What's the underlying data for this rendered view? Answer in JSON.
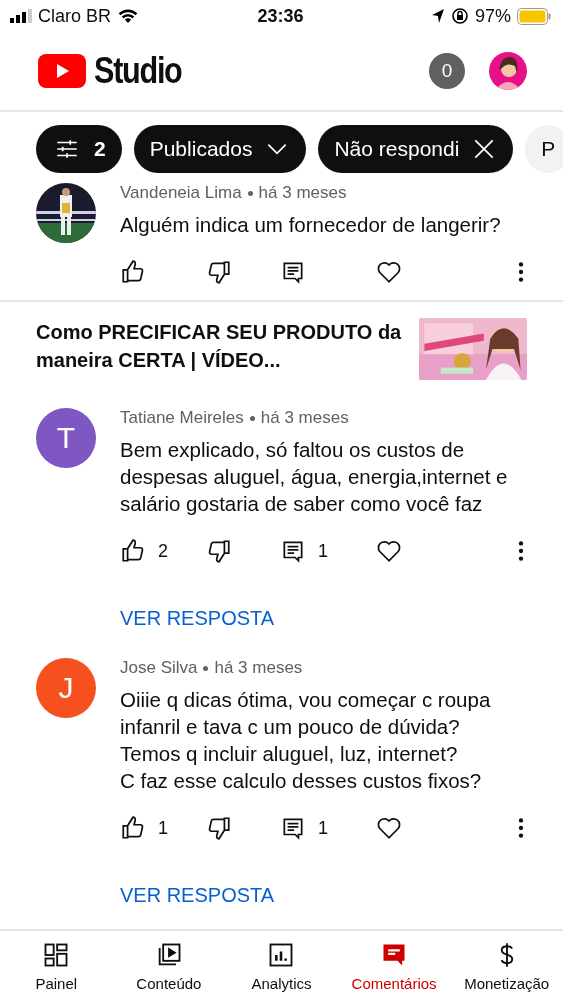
{
  "status_bar": {
    "carrier": "Claro BR",
    "time": "23:36",
    "battery": "97%"
  },
  "header": {
    "logo_text": "Studio",
    "notification_count": "0"
  },
  "filters": [
    {
      "kind": "settings",
      "label": "2"
    },
    {
      "kind": "dropdown",
      "label": "Publicados"
    },
    {
      "kind": "removable",
      "label": "Não respondi"
    },
    {
      "kind": "plain",
      "label": "P"
    }
  ],
  "items": [
    {
      "kind": "comment",
      "author": "Vandeneia Lima",
      "time": "há 3 meses",
      "text": "Alguém indica um fornecedor de langerir?"
    },
    {
      "kind": "video",
      "title": "Como PRECIFICAR SEU PRODUTO da maneira CERTA | VÍDEO..."
    },
    {
      "kind": "comment",
      "author": "Tatiane Meireles",
      "time": "há 3 meses",
      "text": "Bem explicado, só faltou os custos de despesas aluguel, água, energia,internet e salário gostaria de saber como você faz",
      "avatar": {
        "kind": "letter",
        "letter": "T",
        "color": "#7e57c2"
      },
      "likes": "2",
      "replies": "1",
      "reply_link": "VER RESPOSTA"
    },
    {
      "kind": "comment",
      "author": "Jose Silva",
      "time": "há 3 meses",
      "text": "Oiiie q dicas ótima, vou começar c roupa infanril e tava c um pouco de dúvida?\nTemos q incluir aluguel, luz, internet?\nC faz esse calculo desses custos fixos?",
      "avatar": {
        "kind": "letter",
        "letter": "J",
        "color": "#f4511e"
      },
      "likes": "1",
      "replies": "1",
      "reply_link": "VER RESPOSTA"
    }
  ],
  "nav": [
    {
      "label": "Painel",
      "selected": false
    },
    {
      "label": "Conteúdo",
      "selected": false
    },
    {
      "label": "Analytics",
      "selected": false
    },
    {
      "label": "Comentários",
      "selected": true
    },
    {
      "label": "Monetização",
      "selected": false
    }
  ]
}
